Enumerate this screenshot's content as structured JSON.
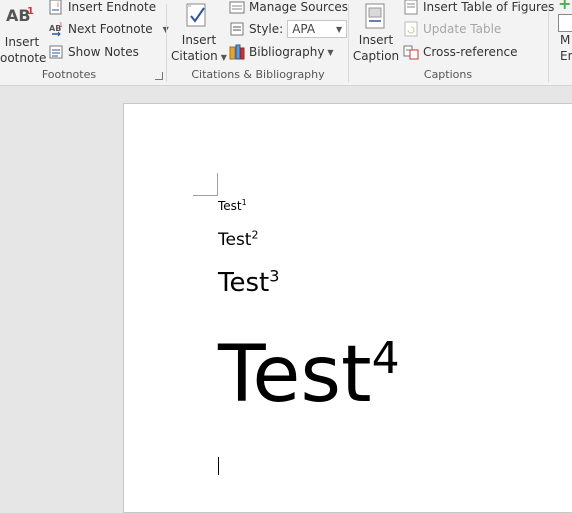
{
  "footnotes": {
    "insert_footnote_label_line1": "Insert",
    "insert_footnote_label_line2": "ootnote",
    "insert_footnote_icon_text": "AB",
    "insert_footnote_icon_super": "1",
    "insert_endnote_label": "Insert Endnote",
    "next_footnote_label": "Next Footnote",
    "show_notes_label": "Show Notes",
    "group_label": "Footnotes"
  },
  "citations": {
    "insert_citation_line1": "Insert",
    "insert_citation_line2": "Citation",
    "manage_sources_label": "Manage Sources",
    "style_label": "Style:",
    "style_value": "APA",
    "bibliography_label": "Bibliography",
    "group_label": "Citations & Bibliography"
  },
  "captions": {
    "insert_caption_line1": "Insert",
    "insert_caption_line2": "Caption",
    "insert_table_of_figures_label": "Insert Table of Figures",
    "update_table_label": "Update Table",
    "cross_reference_label": "Cross-reference",
    "group_label": "Captions"
  },
  "index": {
    "mark_entry_line1": "M",
    "mark_entry_line2": "En"
  },
  "document": {
    "lines": [
      {
        "text": "Test",
        "sup": "1"
      },
      {
        "text": "Test",
        "sup": "2"
      },
      {
        "text": "Test",
        "sup": "3"
      },
      {
        "text": "Test",
        "sup": "4"
      }
    ]
  },
  "colors": {
    "ribbon_bg": "#f3f3f3",
    "workspace_bg": "#e6e6e6",
    "accent_red": "#d13438",
    "accent_blue": "#2b579a"
  }
}
